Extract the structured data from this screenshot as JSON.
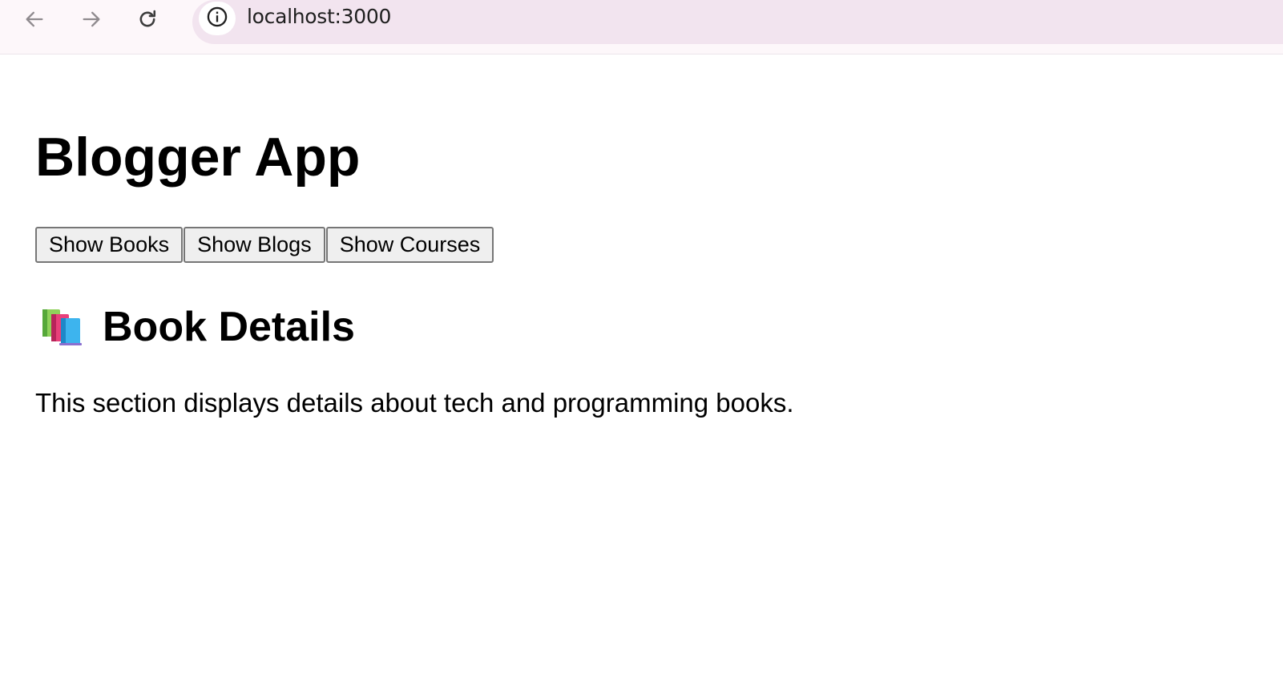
{
  "browser": {
    "url": "localhost:3000",
    "icons": {
      "back": "arrow-left-icon",
      "forward": "arrow-right-icon",
      "reload": "reload-icon",
      "site_info": "info-icon"
    },
    "colors": {
      "toolbar_bg": "#fdf7fa",
      "omnibox_bg": "#f2e4ef"
    }
  },
  "app": {
    "title": "Blogger App",
    "buttons": [
      {
        "label": "Show Books"
      },
      {
        "label": "Show Blogs"
      },
      {
        "label": "Show Courses"
      }
    ],
    "section": {
      "icon": "books-icon",
      "heading": "Book Details",
      "description": "This section displays details about tech and programming books."
    }
  }
}
